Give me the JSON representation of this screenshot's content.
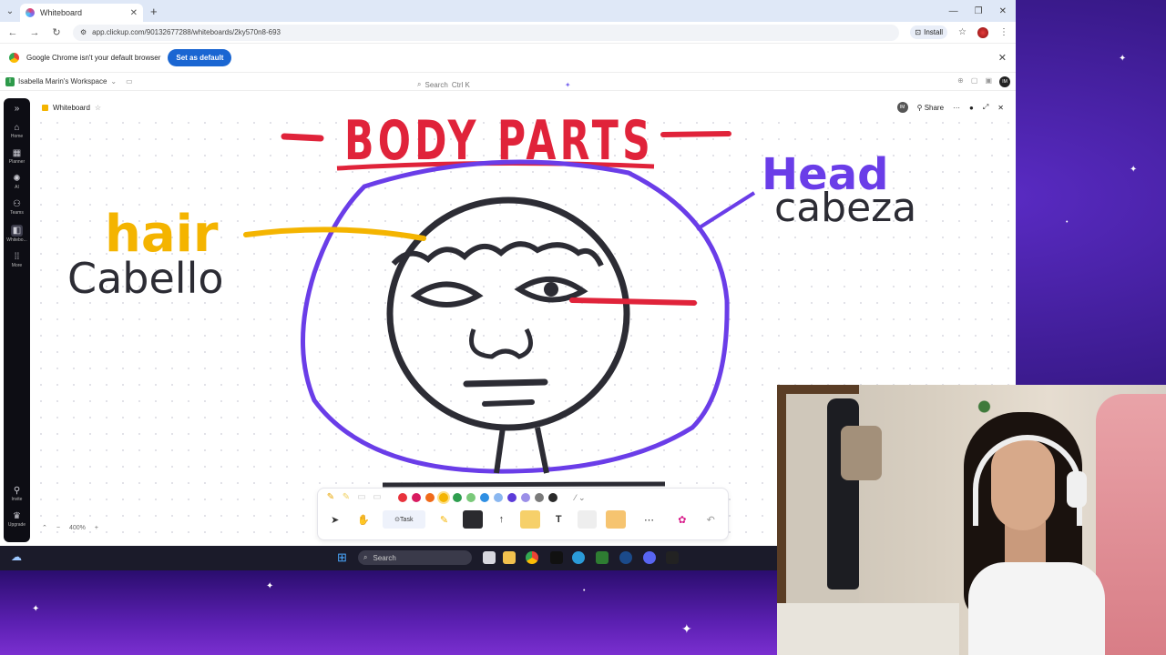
{
  "browser": {
    "tab_title": "Whiteboard",
    "url": "app.clickup.com/90132677288/whiteboards/2ky570n8-693",
    "install_label": "Install",
    "default_browser_msg": "Google Chrome isn't your default browser",
    "set_default_label": "Set as default"
  },
  "app": {
    "workspace_name": "Isabella Marin's Workspace",
    "search_placeholder": "Search",
    "search_shortcut": "Ctrl K",
    "me_initials": "IM"
  },
  "sidebar": {
    "items": [
      {
        "label": "Home",
        "icon": "home-icon"
      },
      {
        "label": "Planner",
        "icon": "calendar-icon"
      },
      {
        "label": "AI",
        "icon": "ai-icon"
      },
      {
        "label": "Teams",
        "icon": "teams-icon"
      },
      {
        "label": "Whitebo...",
        "icon": "whiteboard-icon"
      },
      {
        "label": "More",
        "icon": "grid-icon"
      }
    ],
    "invite_label": "Invite",
    "upgrade_label": "Upgrade"
  },
  "whiteboard": {
    "title": "Whiteboard",
    "share_label": "Share",
    "avatar_initials": "IM",
    "zoom": "400%"
  },
  "canvas_text": {
    "title": "BODY PARTS",
    "hair_en": "hair",
    "hair_es": "Cabello",
    "head_en": "Head",
    "head_es": "cabeza"
  },
  "toolbar": {
    "task_label": "Task",
    "text_tool": "T",
    "colors": [
      "#e8323c",
      "#d81b60",
      "#f06a19",
      "#f4b400",
      "#2e9e4f",
      "#7ac97a",
      "#2f8fe3",
      "#8ab7f0",
      "#5b3bd9",
      "#9b8fe8",
      "#7a7a7a",
      "#2a2a2a"
    ]
  },
  "taskbar": {
    "search_placeholder": "Search"
  },
  "colors": {
    "title_red": "#e0233a",
    "hair_yellow": "#f4b400",
    "head_purple": "#6a3de8",
    "outline_black": "#2c2c34"
  }
}
